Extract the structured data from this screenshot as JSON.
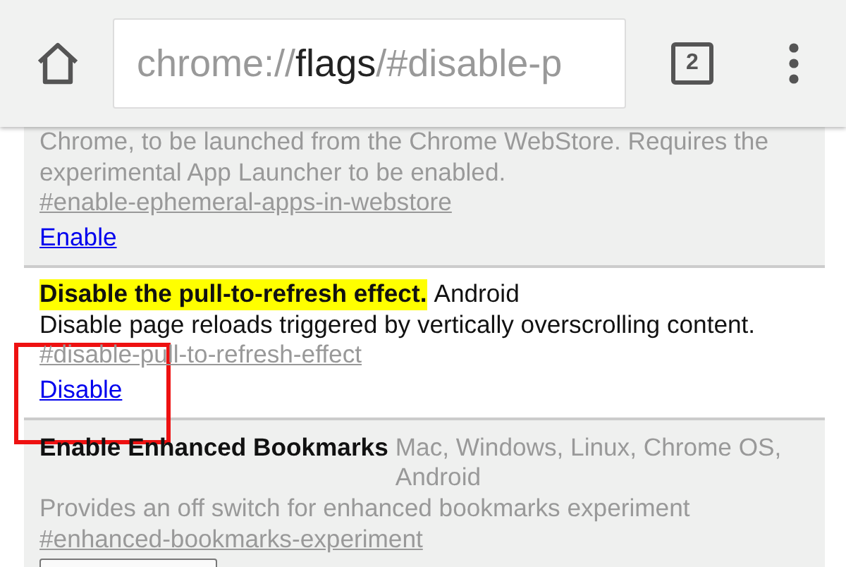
{
  "toolbar": {
    "url": {
      "scheme": "chrome://",
      "host": "flags",
      "path": "/#disable-p"
    },
    "tab_count": "2"
  },
  "experiments": [
    {
      "enabled": false,
      "description": "Chrome, to be launched from the Chrome WebStore. Requires the experimental App Launcher to be enabled.",
      "anchor": "#enable-ephemeral-apps-in-webstore",
      "control": {
        "kind": "link",
        "label": "Enable"
      }
    },
    {
      "enabled": true,
      "highlighted": true,
      "title": "Disable the pull-to-refresh effect.",
      "platforms": "Android",
      "description": "Disable page reloads triggered by vertically overscrolling content.",
      "anchor": "#disable-pull-to-refresh-effect",
      "control": {
        "kind": "link",
        "label": "Disable"
      }
    },
    {
      "enabled": false,
      "highlighted": false,
      "title": "Enable Enhanced Bookmarks",
      "platforms": "Mac, Windows, Linux, Chrome OS, Android",
      "description": "Provides an off switch for enhanced bookmarks experiment",
      "anchor": "#enhanced-bookmarks-experiment",
      "control": {
        "kind": "select"
      }
    }
  ],
  "annotation": {
    "kind": "box"
  }
}
